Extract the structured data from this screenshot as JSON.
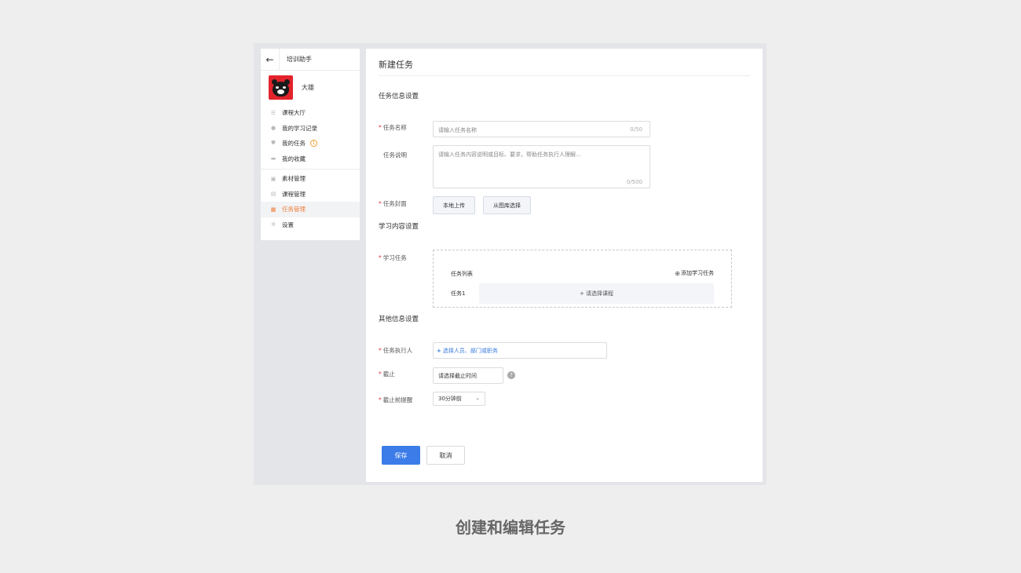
{
  "sidebar": {
    "back_icon": "←",
    "app_title": "培训助手",
    "user_name": "大雄",
    "items": [
      {
        "label": "课程大厅",
        "icon": "list-icon"
      },
      {
        "label": "我的学习记录",
        "icon": "clock-icon"
      },
      {
        "label": "我的任务",
        "icon": "shield-icon",
        "badge": "1"
      },
      {
        "label": "我的收藏",
        "icon": "folder-icon"
      }
    ],
    "admin_items": [
      {
        "label": "素材管理",
        "icon": "images-icon"
      },
      {
        "label": "课程管理",
        "icon": "copy-icon"
      },
      {
        "label": "任务管理",
        "icon": "task-icon",
        "active": true
      },
      {
        "label": "设置",
        "icon": "gear-icon"
      }
    ]
  },
  "main": {
    "page_title": "新建任务",
    "sections": {
      "task_info": "任务信息设置",
      "content": "学习内容设置",
      "other": "其他信息设置"
    },
    "fields": {
      "name_label": "任务名称",
      "name_placeholder": "请输入任务名称",
      "name_count": "0/50",
      "desc_label": "任务说明",
      "desc_placeholder": "请输入任务内容说明或目标、要求，帮助任务执行人理解...",
      "desc_count": "0/500",
      "cover_label": "任务封面",
      "cover_upload": "本地上传",
      "cover_gallery": "从图库选择",
      "study_label": "学习任务",
      "task_list_label": "任务列表",
      "add_study_task": "添加学习任务",
      "task1_label": "任务1",
      "choose_course": "+ 请选择课程",
      "assignee_label": "任务执行人",
      "assignee_plus": "+",
      "assignee_text": "选择人员、部门或职务",
      "deadline_label": "截止",
      "deadline_placeholder": "请选择截止时间",
      "help_icon": "?",
      "remind_label": "截止前提醒",
      "remind_value": "30分钟前"
    },
    "actions": {
      "save": "保存",
      "cancel": "取消"
    }
  },
  "caption": "创建和编辑任务",
  "colors": {
    "primary": "#3b7ce8",
    "active": "#f07c3a",
    "required": "#e4393c",
    "avatar_bg": "#e3232b"
  }
}
